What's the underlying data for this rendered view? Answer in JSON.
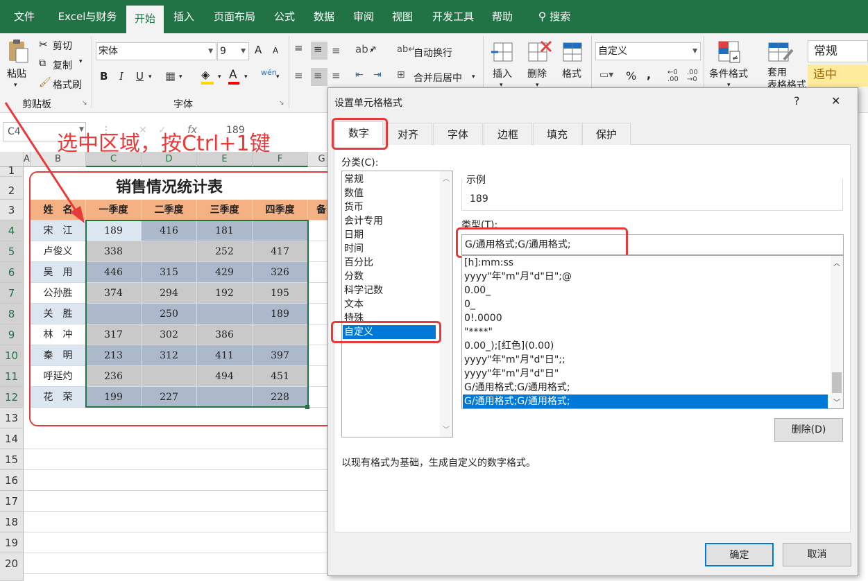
{
  "ribbon_tabs": [
    "文件",
    "Excel与财务",
    "开始",
    "插入",
    "页面布局",
    "公式",
    "数据",
    "审阅",
    "视图",
    "开发工具",
    "帮助"
  ],
  "search_label": "搜索",
  "clipboard": {
    "paste": "粘贴",
    "cut": "剪切",
    "copy": "复制",
    "format_painter": "格式刷",
    "group": "剪贴板"
  },
  "font": {
    "name": "宋体",
    "size": "9",
    "group": "字体",
    "bold": "B",
    "italic": "I",
    "underline": "U",
    "grow": "A",
    "shrink": "A",
    "wen": "wén"
  },
  "align": {
    "wrap": "自动换行",
    "merge": "合并后居中"
  },
  "number_format": "自定义",
  "cells_group": {
    "insert": "插入",
    "delete": "删除",
    "format": "格式",
    "cond": "条件格式",
    "table": "套用\n表格格式"
  },
  "styles": {
    "normal": "常规",
    "good": "适中"
  },
  "formula_bar": {
    "name_box": "C4",
    "value": "189",
    "fx": "fx"
  },
  "annotation": "选中区域，按Ctrl+1键",
  "columns": [
    "A",
    "B",
    "C",
    "D",
    "E",
    "F",
    "G"
  ],
  "rows": [
    "1",
    "2",
    "3",
    "4",
    "5",
    "6",
    "7",
    "8",
    "9",
    "10",
    "11",
    "12",
    "13",
    "14",
    "15",
    "16",
    "17",
    "18",
    "19",
    "20"
  ],
  "table": {
    "title": "销售情况统计表",
    "headers": [
      "姓　名",
      "一季度",
      "二季度",
      "三季度",
      "四季度",
      "备"
    ],
    "data": [
      [
        "宋　江",
        "189",
        "416",
        "181",
        ""
      ],
      [
        "卢俊义",
        "338",
        "",
        "252",
        "417"
      ],
      [
        "吴　用",
        "446",
        "315",
        "429",
        "326"
      ],
      [
        "公孙胜",
        "374",
        "294",
        "192",
        "195"
      ],
      [
        "关　胜",
        "",
        "250",
        "",
        "189"
      ],
      [
        "林　冲",
        "317",
        "302",
        "386",
        ""
      ],
      [
        "秦　明",
        "213",
        "312",
        "411",
        "397"
      ],
      [
        "呼延灼",
        "236",
        "",
        "494",
        "451"
      ],
      [
        "花　荣",
        "199",
        "227",
        "",
        "228"
      ]
    ]
  },
  "dialog": {
    "title": "设置单元格格式",
    "help": "?",
    "close": "✕",
    "tabs": [
      "数字",
      "对齐",
      "字体",
      "边框",
      "填充",
      "保护"
    ],
    "category_label": "分类(C):",
    "categories": [
      "常规",
      "数值",
      "货币",
      "会计专用",
      "日期",
      "时间",
      "百分比",
      "分数",
      "科学记数",
      "文本",
      "特殊",
      "自定义"
    ],
    "sample_label": "示例",
    "sample_value": "189",
    "type_label": "类型(T):",
    "type_value": "G/通用格式;G/通用格式;",
    "type_list": [
      "[h]:mm:ss",
      "yyyy\"年\"m\"月\"d\"日\";@",
      "0.00_",
      "0_",
      "0!.0000",
      "\"****\"",
      "0.00_);[红色](0.00)",
      "yyyy\"年\"m\"月\"d\"日\";;",
      "yyyy\"年\"m\"月\"d\"日\"",
      "G/通用格式;G/通用格式;",
      "G/通用格式;G/通用格式;"
    ],
    "delete_button": "删除(D)",
    "description": "以现有格式为基础，生成自定义的数字格式。",
    "ok": "确定",
    "cancel": "取消"
  },
  "colors": {
    "excel_green": "#217346",
    "selection_blue": "#0078d7",
    "annotation_red": "#e53b3b",
    "header_orange": "#f4b183",
    "cell_gray": "#acb9ca",
    "name_blue": "#dce6f1"
  }
}
